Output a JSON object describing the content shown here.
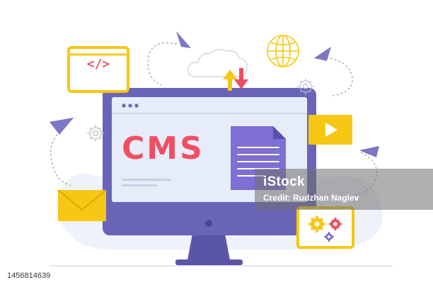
{
  "illustration": {
    "headline": "CMS",
    "code_badge": "</>",
    "colors": {
      "monitor_frame": "#6a64b8",
      "screen": "#e6ecf8",
      "cms_text": "#ef4f63",
      "document": "#7d6fd3",
      "accent_yellow": "#f6c713",
      "arrow_up": "#f6c713",
      "arrow_down": "#ef4f63"
    },
    "icons": [
      "code-window-icon",
      "cloud-icon",
      "upload-arrow-icon",
      "download-arrow-icon",
      "globe-icon",
      "gear-icon",
      "paper-plane-icon",
      "document-icon",
      "video-play-icon",
      "email-envelope-icon",
      "settings-panel-icon"
    ]
  },
  "watermark": {
    "logo": "iStock",
    "credit": "Credit: Rudzhan Naglev"
  },
  "footer": {
    "image_id": "1456814639"
  }
}
